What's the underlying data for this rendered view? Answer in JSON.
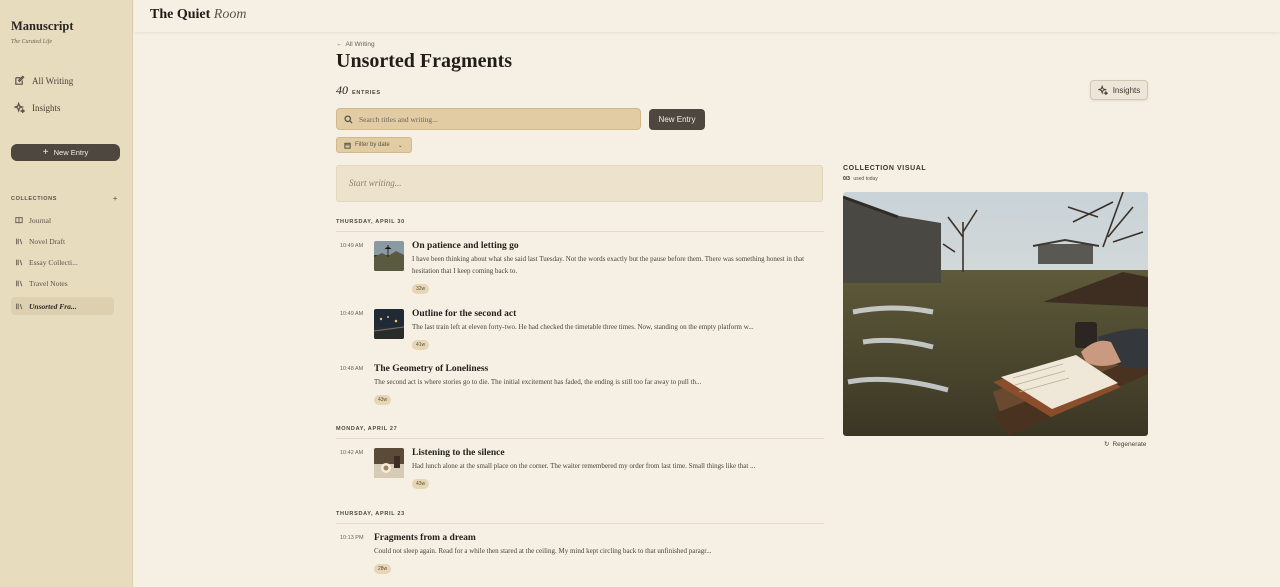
{
  "sidebar": {
    "brand_title": "Manuscript",
    "brand_subtitle": "The Curated Life",
    "nav": [
      {
        "label": "All Writing",
        "icon": "edit-icon"
      },
      {
        "label": "Insights",
        "icon": "sparkle-icon"
      }
    ],
    "new_entry_label": "New Entry",
    "collections_heading": "COLLECTIONS",
    "collections_add": "+",
    "collections": [
      {
        "label": "Journal",
        "icon": "book-icon"
      },
      {
        "label": "Novel Draft",
        "icon": "stack-icon"
      },
      {
        "label": "Essay Collecti...",
        "icon": "stack-icon"
      },
      {
        "label": "Travel Notes",
        "icon": "stack-icon"
      },
      {
        "label": "Unsorted Fra...",
        "icon": "stack-icon",
        "active": true
      }
    ]
  },
  "topbar": {
    "title_bold": "The Quiet",
    "title_italic": "Room"
  },
  "main": {
    "back_label": "All Writing",
    "title": "Unsorted Fragments",
    "count": "40",
    "count_label": "ENTRIES",
    "insights_label": "Insights",
    "search_placeholder": "Search titles and writing...",
    "new_entry_label": "New Entry",
    "filter_label": "Filter by date",
    "start_writing_placeholder": "Start writing..."
  },
  "groups": [
    {
      "date": "THURSDAY, APRIL 30",
      "entries": [
        {
          "time": "10:49 AM",
          "title": "On patience and letting go",
          "text": "I have been thinking about what she said last Tuesday. Not the words exactly but the pause before them. There was something honest in that hesitation that I keep coming back to.",
          "words": "32w",
          "thumb": "landscape-thumb"
        },
        {
          "time": "10:49 AM",
          "title": "Outline for the second act",
          "text": "The last train left at eleven forty-two. He had checked the timetable three times. Now, standing on the empty platform w...",
          "words": "41w",
          "thumb": "night-thumb"
        },
        {
          "time": "10:48 AM",
          "title": "The Geometry of Loneliness",
          "text": "The second act is where stories go to die. The initial excitement has faded, the ending is still too far away to pull th...",
          "words": "43w"
        }
      ]
    },
    {
      "date": "MONDAY, APRIL 27",
      "entries": [
        {
          "time": "10:42 AM",
          "title": "Listening to the silence",
          "text": "Had lunch alone at the small place on the corner. The waiter remembered my order from last time. Small things like that ...",
          "words": "43w",
          "thumb": "cafe-thumb"
        }
      ]
    },
    {
      "date": "THURSDAY, APRIL 23",
      "entries": [
        {
          "time": "10:13 PM",
          "title": "Fragments from a dream",
          "text": "Could not sleep again. Read for a while then stared at the ceiling. My mind kept circling back to that unfinished paragr...",
          "words": "28w"
        }
      ]
    }
  ],
  "visual": {
    "label": "COLLECTION VISUAL",
    "usage_count": "0/3",
    "usage_text": "used today",
    "regenerate_label": "Regenerate"
  }
}
